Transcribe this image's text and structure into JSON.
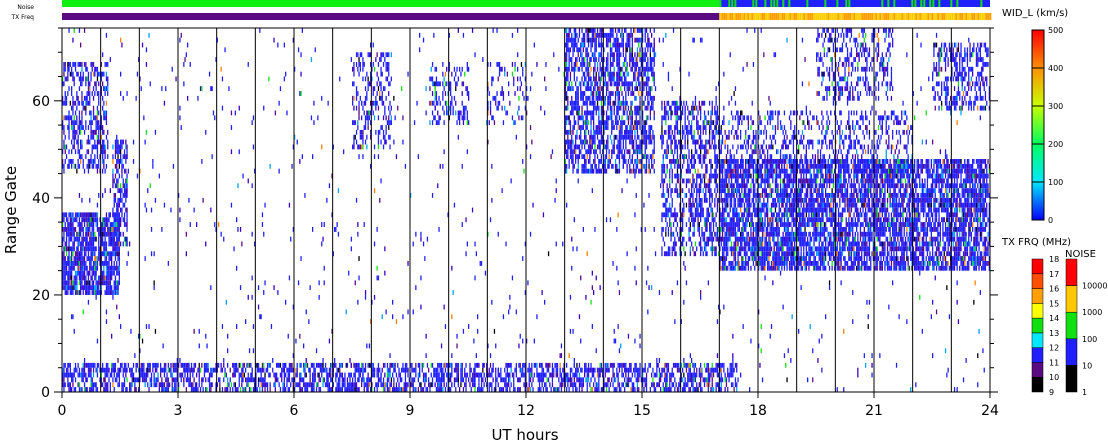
{
  "chart_data": {
    "type": "heatmap",
    "xlabel": "UT hours",
    "ylabel": "Range Gate",
    "xlim": [
      0,
      24
    ],
    "ylim": [
      0,
      75
    ],
    "xticks": [
      "0",
      "3",
      "6",
      "9",
      "12",
      "15",
      "18",
      "21",
      "24"
    ],
    "yticks": [
      "0",
      "20",
      "40",
      "60"
    ],
    "hour_lines": true,
    "top_bars": {
      "noise_label": "Noise",
      "txfreq_label": "TX Freq",
      "switch_hour": 17
    },
    "colorbar_width": {
      "title": "WID_L (km/s)",
      "ticks": [
        "0",
        "100",
        "200",
        "300",
        "400",
        "500"
      ]
    },
    "colorbar_txfreq": {
      "title": "TX FRQ (MHz)",
      "ticks": [
        "9",
        "10",
        "11",
        "12",
        "13",
        "14",
        "15",
        "16",
        "17",
        "18"
      ],
      "colors": [
        "#000000",
        "#5a0a82",
        "#2020ff",
        "#00e8ff",
        "#10e010",
        "#ffff00",
        "#ffa000",
        "#ff5000",
        "#ff0000"
      ]
    },
    "colorbar_noise": {
      "title": "NOISE",
      "ticks": [
        "1",
        "10",
        "100",
        "1000",
        "10000"
      ],
      "colors": [
        "#000000",
        "#2020ff",
        "#10e010",
        "#ffc800",
        "#ff0000"
      ]
    },
    "echo_regions": [
      {
        "t": [
          0,
          1.5
        ],
        "g": [
          20,
          37
        ],
        "density": 0.8
      },
      {
        "t": [
          0,
          1.2
        ],
        "g": [
          45,
          68
        ],
        "density": 0.45
      },
      {
        "t": [
          1.3,
          1.7
        ],
        "g": [
          30,
          52
        ],
        "density": 0.6
      },
      {
        "t": [
          7.5,
          8.5
        ],
        "g": [
          50,
          70
        ],
        "density": 0.35
      },
      {
        "t": [
          9.5,
          10.5
        ],
        "g": [
          55,
          68
        ],
        "density": 0.3
      },
      {
        "t": [
          11,
          12
        ],
        "g": [
          55,
          68
        ],
        "density": 0.2
      },
      {
        "t": [
          13,
          15.3
        ],
        "g": [
          45,
          75
        ],
        "density": 0.6
      },
      {
        "t": [
          15.5,
          17
        ],
        "g": [
          28,
          60
        ],
        "density": 0.5
      },
      {
        "t": [
          17,
          24
        ],
        "g": [
          25,
          48
        ],
        "density": 0.75
      },
      {
        "t": [
          17,
          22
        ],
        "g": [
          45,
          58
        ],
        "density": 0.3
      },
      {
        "t": [
          19.5,
          21.5
        ],
        "g": [
          60,
          75
        ],
        "density": 0.35
      },
      {
        "t": [
          22.5,
          24
        ],
        "g": [
          58,
          72
        ],
        "density": 0.45
      },
      {
        "t": [
          0,
          17.5
        ],
        "g": [
          0,
          6
        ],
        "density": 0.55
      },
      {
        "t": [
          0,
          24
        ],
        "g": [
          0,
          75
        ],
        "density": 0.02
      }
    ]
  }
}
